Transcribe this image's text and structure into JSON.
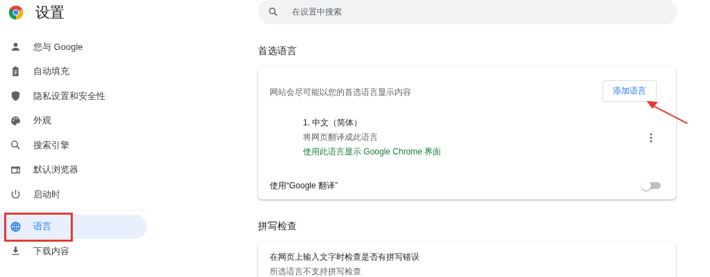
{
  "header": {
    "title": "设置"
  },
  "search": {
    "placeholder": "在设置中搜索"
  },
  "sidebar": {
    "items": [
      {
        "label": "您与 Google",
        "selected": false
      },
      {
        "label": "自动填充",
        "selected": false
      },
      {
        "label": "隐私设置和安全性",
        "selected": false
      },
      {
        "label": "外观",
        "selected": false
      },
      {
        "label": "搜索引擎",
        "selected": false
      },
      {
        "label": "默认浏览器",
        "selected": false
      },
      {
        "label": "启动时",
        "selected": false
      },
      {
        "label": "语言",
        "selected": true
      },
      {
        "label": "下载内容",
        "selected": false
      }
    ]
  },
  "languages": {
    "title": "首选语言",
    "description": "网站会尽可能以您的首选语言显示内容",
    "add_button": "添加语言",
    "items": [
      {
        "name": "1. 中文（简体）",
        "subtitle": "将网页翻译成此语言",
        "note": "使用此语言显示 Google Chrome 界面"
      }
    ],
    "translate": {
      "label": "使用“Google 翻译”",
      "on": false
    }
  },
  "spellcheck": {
    "title": "拼写检查",
    "label": "在网页上输入文字时检查是否有拼写错误",
    "subtitle": "所选语言不支持拼写检查"
  }
}
